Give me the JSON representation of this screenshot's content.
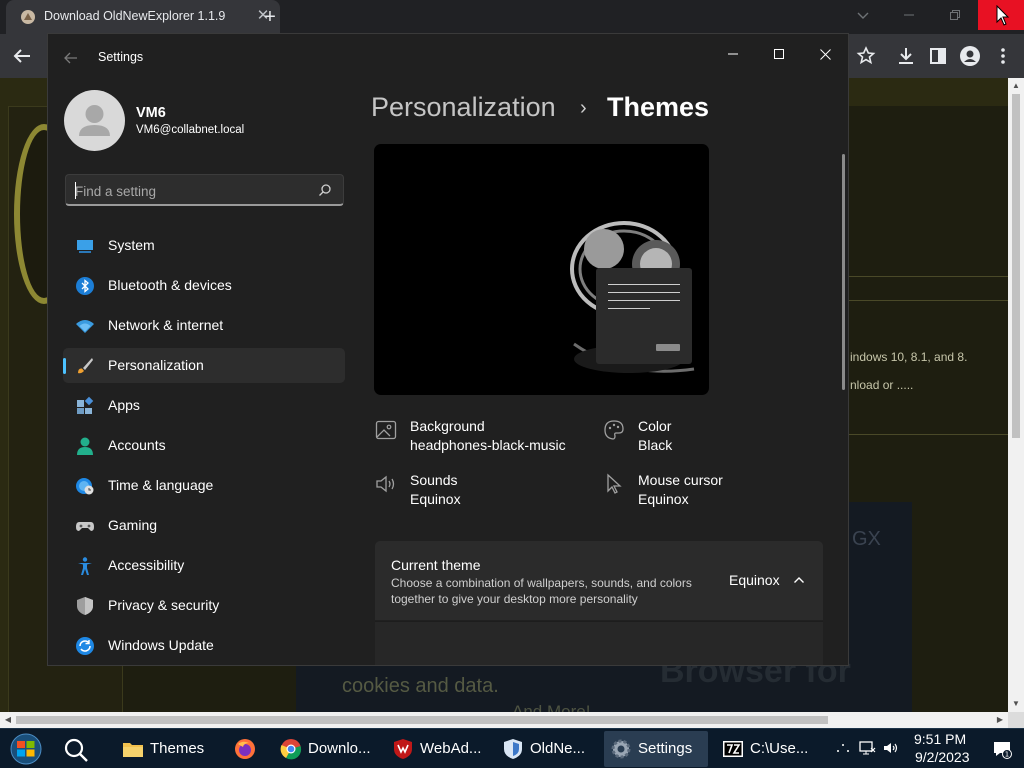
{
  "browser": {
    "tab_title": "Download OldNewExplorer 1.1.9",
    "tab_close_glyph": "✕",
    "new_tab_glyph": "+",
    "page": {
      "text_line1": "indows 10, 8.1, and 8.",
      "text_line2": "nload or .....",
      "ad_gx": "GX",
      "ad_line1": "cookies and data.",
      "ad_line2": "Browser for",
      "ad_line3": "And More!"
    }
  },
  "settings": {
    "window_title": "Settings",
    "user": {
      "name": "VM6",
      "email": "VM6@collabnet.local"
    },
    "search": {
      "placeholder": "Find a setting",
      "value": ""
    },
    "nav": [
      {
        "label": "System",
        "icon": "system-icon",
        "selected": false
      },
      {
        "label": "Bluetooth & devices",
        "icon": "bluetooth-icon",
        "selected": false
      },
      {
        "label": "Network & internet",
        "icon": "wifi-icon",
        "selected": false
      },
      {
        "label": "Personalization",
        "icon": "brush-icon",
        "selected": true
      },
      {
        "label": "Apps",
        "icon": "apps-icon",
        "selected": false
      },
      {
        "label": "Accounts",
        "icon": "accounts-icon",
        "selected": false
      },
      {
        "label": "Time & language",
        "icon": "globe-clock-icon",
        "selected": false
      },
      {
        "label": "Gaming",
        "icon": "gamepad-icon",
        "selected": false
      },
      {
        "label": "Accessibility",
        "icon": "accessibility-icon",
        "selected": false
      },
      {
        "label": "Privacy & security",
        "icon": "shield-icon",
        "selected": false
      },
      {
        "label": "Windows Update",
        "icon": "update-icon",
        "selected": false
      }
    ],
    "breadcrumb": {
      "parent": "Personalization",
      "separator": "›",
      "current": "Themes"
    },
    "properties": {
      "background": {
        "label": "Background",
        "value": "headphones-black-music"
      },
      "color": {
        "label": "Color",
        "value": "Black"
      },
      "sounds": {
        "label": "Sounds",
        "value": "Equinox"
      },
      "mouse_cursor": {
        "label": "Mouse cursor",
        "value": "Equinox"
      }
    },
    "current_theme": {
      "title": "Current theme",
      "description": "Choose a combination of wallpapers, sounds, and colors together to give your desktop more personality",
      "value": "Equinox"
    }
  },
  "taskbar": {
    "tasks": [
      {
        "label": "Themes",
        "icon": "folder-icon",
        "active": false
      },
      {
        "label": "",
        "icon": "firefox-icon",
        "active": false
      },
      {
        "label": "Downlo...",
        "icon": "chrome-icon",
        "active": false
      },
      {
        "label": "WebAd...",
        "icon": "webadvisor-icon",
        "active": false
      },
      {
        "label": "OldNe...",
        "icon": "shield-app-icon",
        "active": false
      },
      {
        "label": "Settings",
        "icon": "settings-gear-icon",
        "active": true
      },
      {
        "label": "C:\\Use...",
        "icon": "7zip-icon",
        "active": false
      }
    ],
    "clock": {
      "time": "9:51 PM",
      "date": "9/2/2023"
    },
    "notification_count": "1"
  },
  "colors": {
    "accent": "#4cc2ff",
    "close_red": "#e81123",
    "settings_bg": "#202020",
    "taskbar_bg": "#0b1a2a"
  }
}
